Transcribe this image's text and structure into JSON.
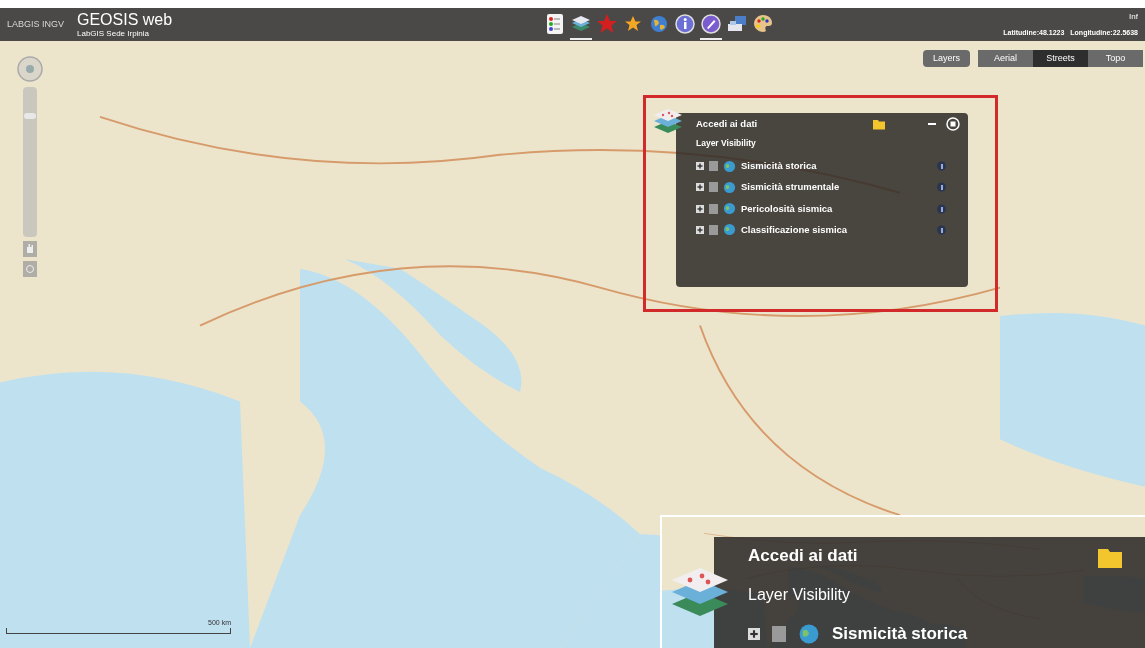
{
  "header": {
    "logo": "LABGIS INGV",
    "title": "GEOSIS web",
    "subtitle": "LabGIS Sede Irpinia",
    "menu_label": "Inf"
  },
  "toolbar": [
    {
      "kind": "legend",
      "selected": false
    },
    {
      "kind": "layers",
      "selected": true
    },
    {
      "kind": "red-star",
      "selected": false
    },
    {
      "kind": "orange-star",
      "selected": false
    },
    {
      "kind": "globe",
      "selected": false
    },
    {
      "kind": "info",
      "selected": false
    },
    {
      "kind": "pen",
      "selected": true
    },
    {
      "kind": "computer",
      "selected": false
    },
    {
      "kind": "palette",
      "selected": false
    }
  ],
  "coordinates": {
    "latitude": "Latitudine:48.1223",
    "longitude": "Longitudine:22.5638"
  },
  "layers_button": "Layers",
  "basemaps": [
    {
      "label": "Aerial",
      "selected": false
    },
    {
      "label": "Streets",
      "selected": true
    },
    {
      "label": "Topo",
      "selected": false
    }
  ],
  "zoom": {
    "level": 0.82
  },
  "scale": "500 km",
  "panel": {
    "title": "Accedi ai dati",
    "section": "Layer Visibility",
    "layers": [
      {
        "name": "Sismicità storica",
        "expanded": false,
        "checked": false
      },
      {
        "name": "Sismicità strumentale",
        "expanded": false,
        "checked": false
      },
      {
        "name": "Pericolosità sismica",
        "expanded": false,
        "checked": false
      },
      {
        "name": "Classificazione sismica",
        "expanded": false,
        "checked": false
      }
    ]
  },
  "zoom_inset": {
    "title": "Accedi ai dati",
    "section": "Layer Visibility",
    "layers": [
      {
        "name": "Sismicità storica",
        "expanded": false,
        "checked": false
      }
    ]
  }
}
